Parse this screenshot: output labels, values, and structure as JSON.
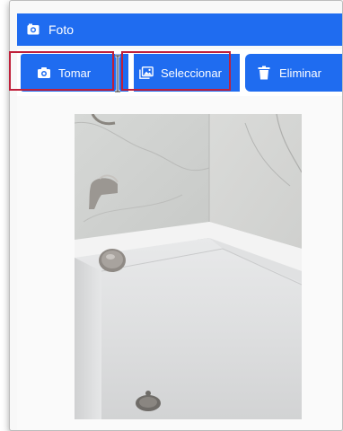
{
  "header": {
    "title": "Foto",
    "icon": "camera-icon"
  },
  "toolbar": {
    "take_label": "Tomar",
    "select_label": "Seleccionar",
    "delete_label": "Eliminar",
    "take_icon": "camera-icon",
    "select_icon": "gallery-icon",
    "delete_icon": "trash-icon"
  },
  "photo": {
    "subject": "bathtub-photo"
  },
  "colors": {
    "accent": "#1f6cf0",
    "highlight": "#c0203a",
    "background": "#f8f8f8"
  }
}
